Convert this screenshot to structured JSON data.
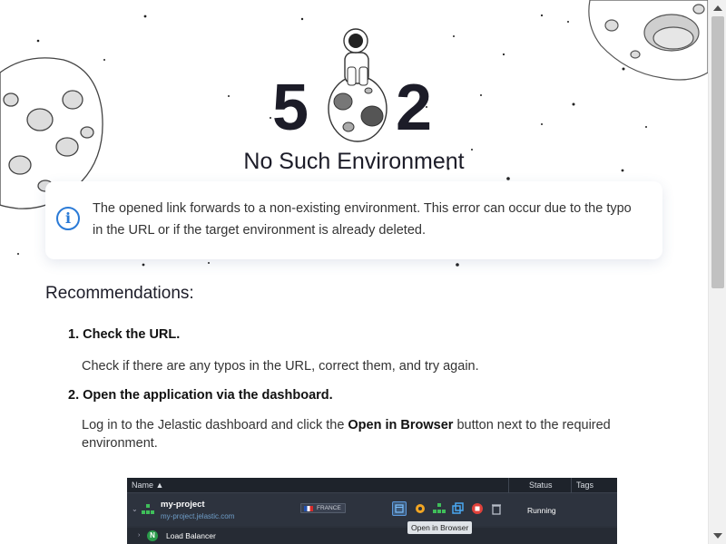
{
  "error": {
    "code_left": "5",
    "code_right": "2",
    "title": "No Such Environment",
    "message": "The opened link forwards to a non-existing environment. This error can occur due to the typo in the URL or if the target environment is already deleted.",
    "info_icon": "i"
  },
  "recommendations": {
    "heading": "Recommendations:",
    "steps": [
      {
        "title": "1. Check the URL.",
        "description": "Check if there are any typos in the URL, correct them, and try again."
      },
      {
        "title": "2. Open the application via the dashboard.",
        "description_before": "Log in to the Jelastic dashboard and click the ",
        "description_bold": "Open in Browser",
        "description_after": " button next to the required environment."
      }
    ]
  },
  "dashboard": {
    "headers": {
      "name": "Name ▲",
      "status": "Status",
      "tags": "Tags"
    },
    "project_name": "my-project",
    "project_url": "my-project.jelastic.com",
    "region": "FRANCE",
    "status": "Running",
    "tooltip": "Open in Browser",
    "child_label": "Load Balancer",
    "child_badge": "N"
  },
  "icons": [
    "astronaut-on-planet",
    "asteroid-icon",
    "info-icon",
    "settings-icon",
    "topology-icon",
    "clone-icon",
    "stop-icon",
    "trash-icon",
    "open-in-browser-icon"
  ],
  "colors": {
    "accent": "#2a7ad6",
    "text_dark": "#1c1c28",
    "dashboard_bg": "#2b313b",
    "running_green": "#2a9b4a",
    "stop_red": "#e0413b"
  }
}
